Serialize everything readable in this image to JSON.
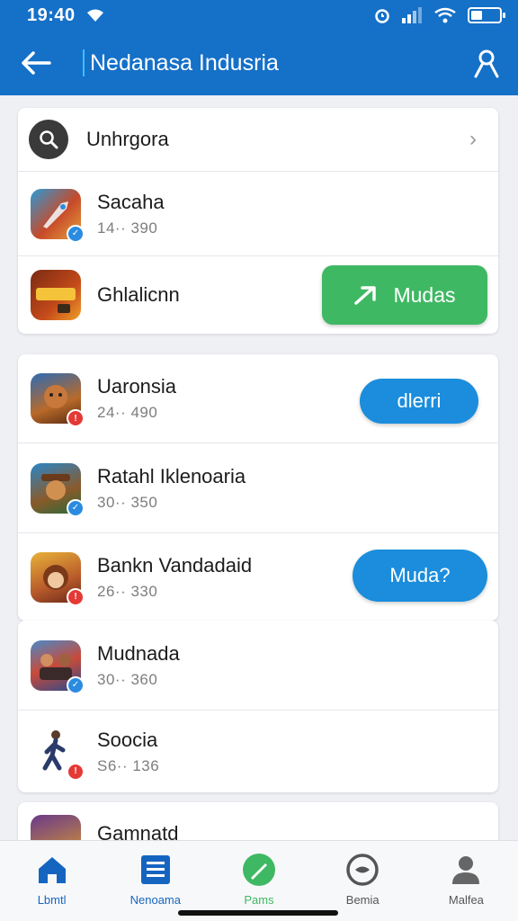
{
  "status": {
    "time": "19:40"
  },
  "header": {
    "title": "Nedanasa Indusria"
  },
  "search_row": {
    "label": "Unhrgora"
  },
  "group1": [
    {
      "title": "Sacaha",
      "subtitle": "14·· 390"
    },
    {
      "title": "Ghlalicnn",
      "button": "Mudas"
    }
  ],
  "group2": [
    {
      "title": "Uaronsia",
      "subtitle": "24·· 490",
      "button": "dlerri"
    },
    {
      "title": "Ratahl Iklenoaria",
      "subtitle": "30·· 350"
    },
    {
      "title": "Bankn Vandadaid",
      "subtitle": "26·· 330",
      "button": "Muda?"
    }
  ],
  "group3": [
    {
      "title": "Mudnada",
      "subtitle": "30·· 360"
    },
    {
      "title": "Soocia",
      "subtitle": "S6·· 136"
    }
  ],
  "group4": [
    {
      "title": "Gamnatd"
    }
  ],
  "nav": [
    {
      "label": "Lbmtl",
      "color": "#1565c0"
    },
    {
      "label": "Nenoama",
      "color": "#1565c0"
    },
    {
      "label": "Pams",
      "color": "#3fb863"
    },
    {
      "label": "Bemia",
      "color": "#555555"
    },
    {
      "label": "Malfea",
      "color": "#555555"
    }
  ],
  "colors": {
    "header": "#1570c8",
    "green_button": "#3fb863",
    "blue_button": "#1b8ddc"
  }
}
